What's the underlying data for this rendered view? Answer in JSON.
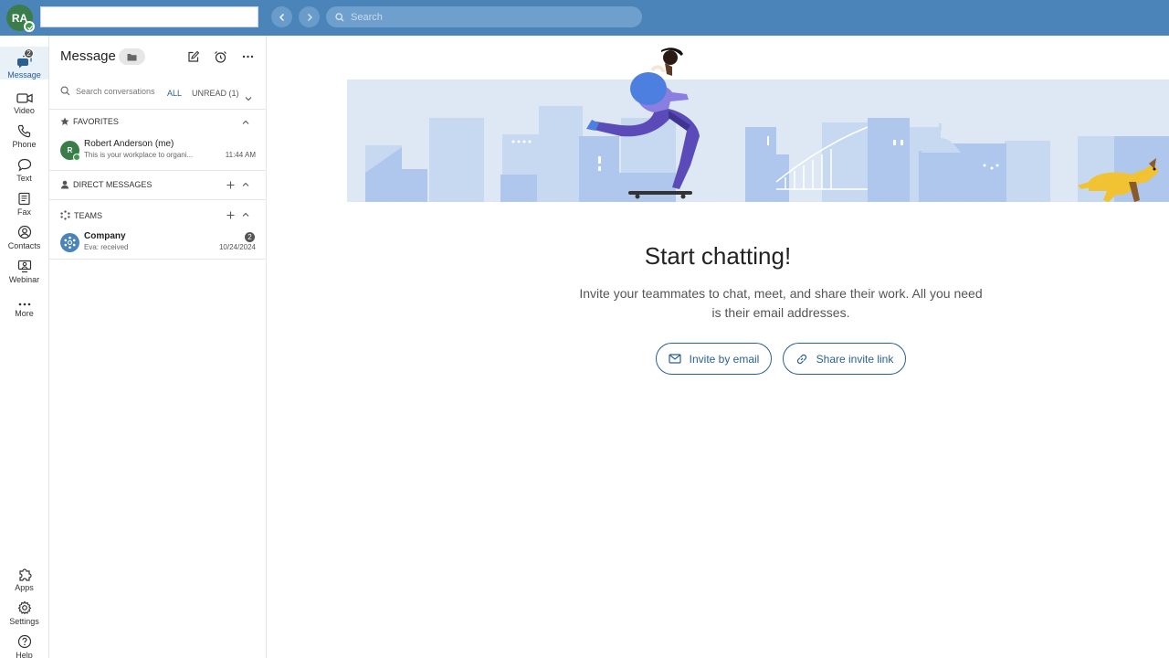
{
  "user": {
    "initials": "RA"
  },
  "topbar": {
    "search_placeholder": "Search"
  },
  "rail": {
    "items": [
      {
        "label": "Message",
        "badge": "2"
      },
      {
        "label": "Video"
      },
      {
        "label": "Phone"
      },
      {
        "label": "Text"
      },
      {
        "label": "Fax"
      },
      {
        "label": "Contacts"
      },
      {
        "label": "Webinar"
      },
      {
        "label": "More"
      }
    ],
    "bottom": [
      {
        "label": "Apps"
      },
      {
        "label": "Settings"
      },
      {
        "label": "Help"
      }
    ]
  },
  "panel": {
    "title": "Message",
    "search_placeholder": "Search conversations",
    "filter_all": "ALL",
    "filter_unread": "UNREAD (1)",
    "sections": {
      "favorites": {
        "title": "FAVORITES",
        "items": [
          {
            "avatar": "R",
            "name": "Robert Anderson (me)",
            "preview": "This is your workplace to organi...",
            "time": "11:44 AM"
          }
        ]
      },
      "direct": {
        "title": "DIRECT MESSAGES"
      },
      "teams": {
        "title": "TEAMS",
        "items": [
          {
            "name": "Company",
            "preview": "Eva: received",
            "time": "10/24/2024",
            "count": "2"
          }
        ]
      }
    }
  },
  "main": {
    "headline": "Start chatting!",
    "subtext": "Invite your teammates to chat, meet, and share their work. All you need is their email addresses.",
    "invite_email_label": "Invite by email",
    "share_link_label": "Share invite link"
  },
  "colors": {
    "topbar": "#4a84b8",
    "accent": "#2b5f94",
    "presence": "#3a9a4a"
  }
}
